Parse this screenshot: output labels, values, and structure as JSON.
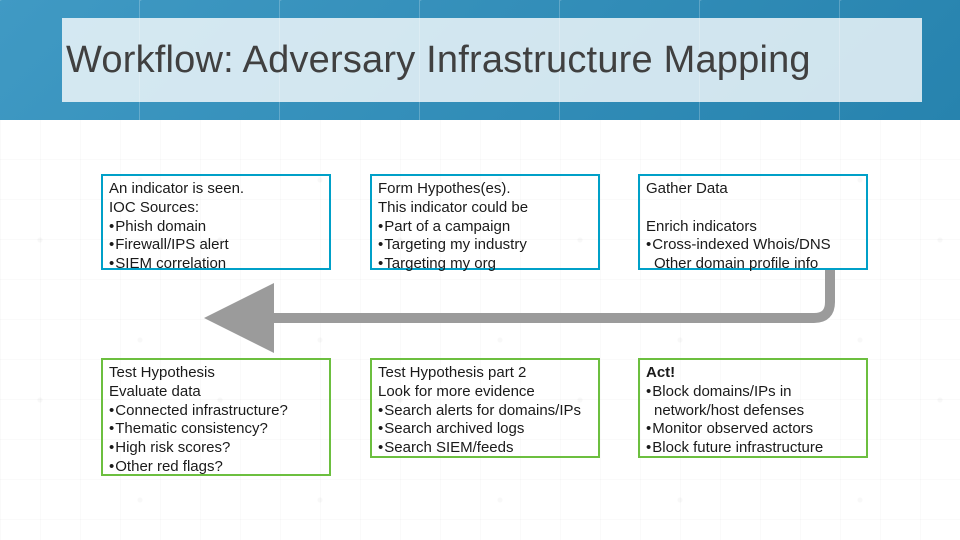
{
  "header": {
    "title": "Workflow: Adversary Infrastructure Mapping"
  },
  "boxes": {
    "b1": {
      "hd": "An indicator is seen.",
      "sub": "IOC Sources:",
      "items": [
        "Phish domain",
        "Firewall/IPS alert",
        "SIEM correlation"
      ]
    },
    "b2": {
      "hd": "Form Hypothes(es).",
      "sub": "This indicator could be",
      "items": [
        "Part of a campaign",
        "Targeting my industry",
        "Targeting my org"
      ]
    },
    "b3": {
      "hd": "Gather Data",
      "sub2": "Enrich indicators",
      "items": [
        "Cross-indexed Whois/DNS"
      ],
      "trail": "Other domain profile info"
    },
    "b4": {
      "hd": "Test Hypothesis",
      "sub": "Evaluate data",
      "items": [
        "Connected infrastructure?",
        "Thematic consistency?",
        "High risk scores?",
        "Other red flags?"
      ]
    },
    "b5": {
      "hd": "Test Hypothesis part 2",
      "sub": "Look for more evidence",
      "items": [
        "Search alerts for domains/IPs",
        "Search archived logs",
        "Search SIEM/feeds"
      ]
    },
    "b6": {
      "hd": "Act!",
      "items": [
        "Block domains/IPs in",
        "Monitor observed actors",
        "Block future infrastructure"
      ],
      "indent1": "network/host defenses"
    }
  },
  "colors": {
    "blue": "#00a0c8",
    "green": "#6cbf3f",
    "arrow": "#9b9b9b"
  }
}
